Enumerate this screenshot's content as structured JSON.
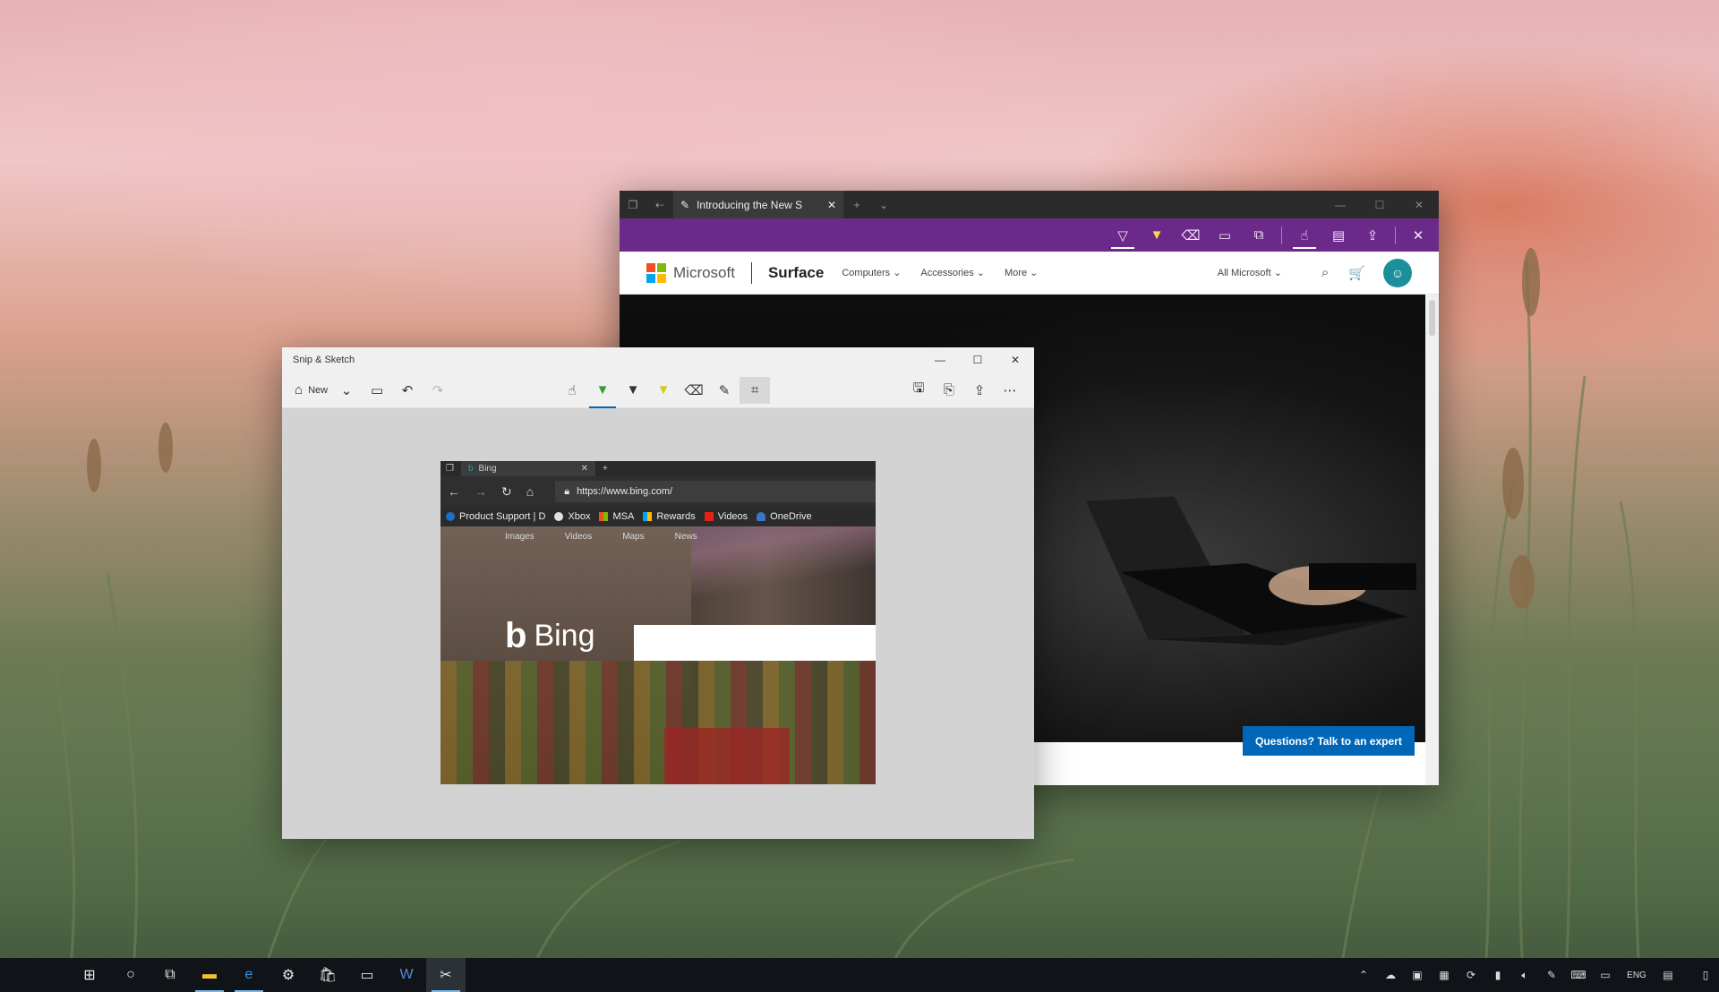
{
  "edge": {
    "tab_title": "Introducing the New S",
    "nav": {
      "brand": "Microsoft",
      "product": "Surface",
      "menu": [
        "Computers ⌄",
        "Accessories ⌄",
        "More ⌄"
      ],
      "all_microsoft": "All Microsoft ⌄"
    },
    "expert_button": "Questions? Talk to an expert"
  },
  "snip": {
    "title": "Snip & Sketch",
    "new_label": "New"
  },
  "capture": {
    "tab_title": "Bing",
    "url": "https://www.bing.com/",
    "favorites": [
      "Product Support | D",
      "Xbox",
      "MSA",
      "Rewards",
      "Videos",
      "OneDrive"
    ],
    "menu": [
      "Images",
      "Videos",
      "Maps",
      "News"
    ],
    "bing_word": "Bing"
  },
  "taskbar": {
    "lang": "ENG"
  },
  "colors": {
    "ink_bar": "#6b2a8a",
    "accent": "#0067b8",
    "ms_red": "#f25022",
    "ms_green": "#7fba00",
    "ms_blue": "#00a4ef",
    "ms_yellow": "#ffb900"
  }
}
